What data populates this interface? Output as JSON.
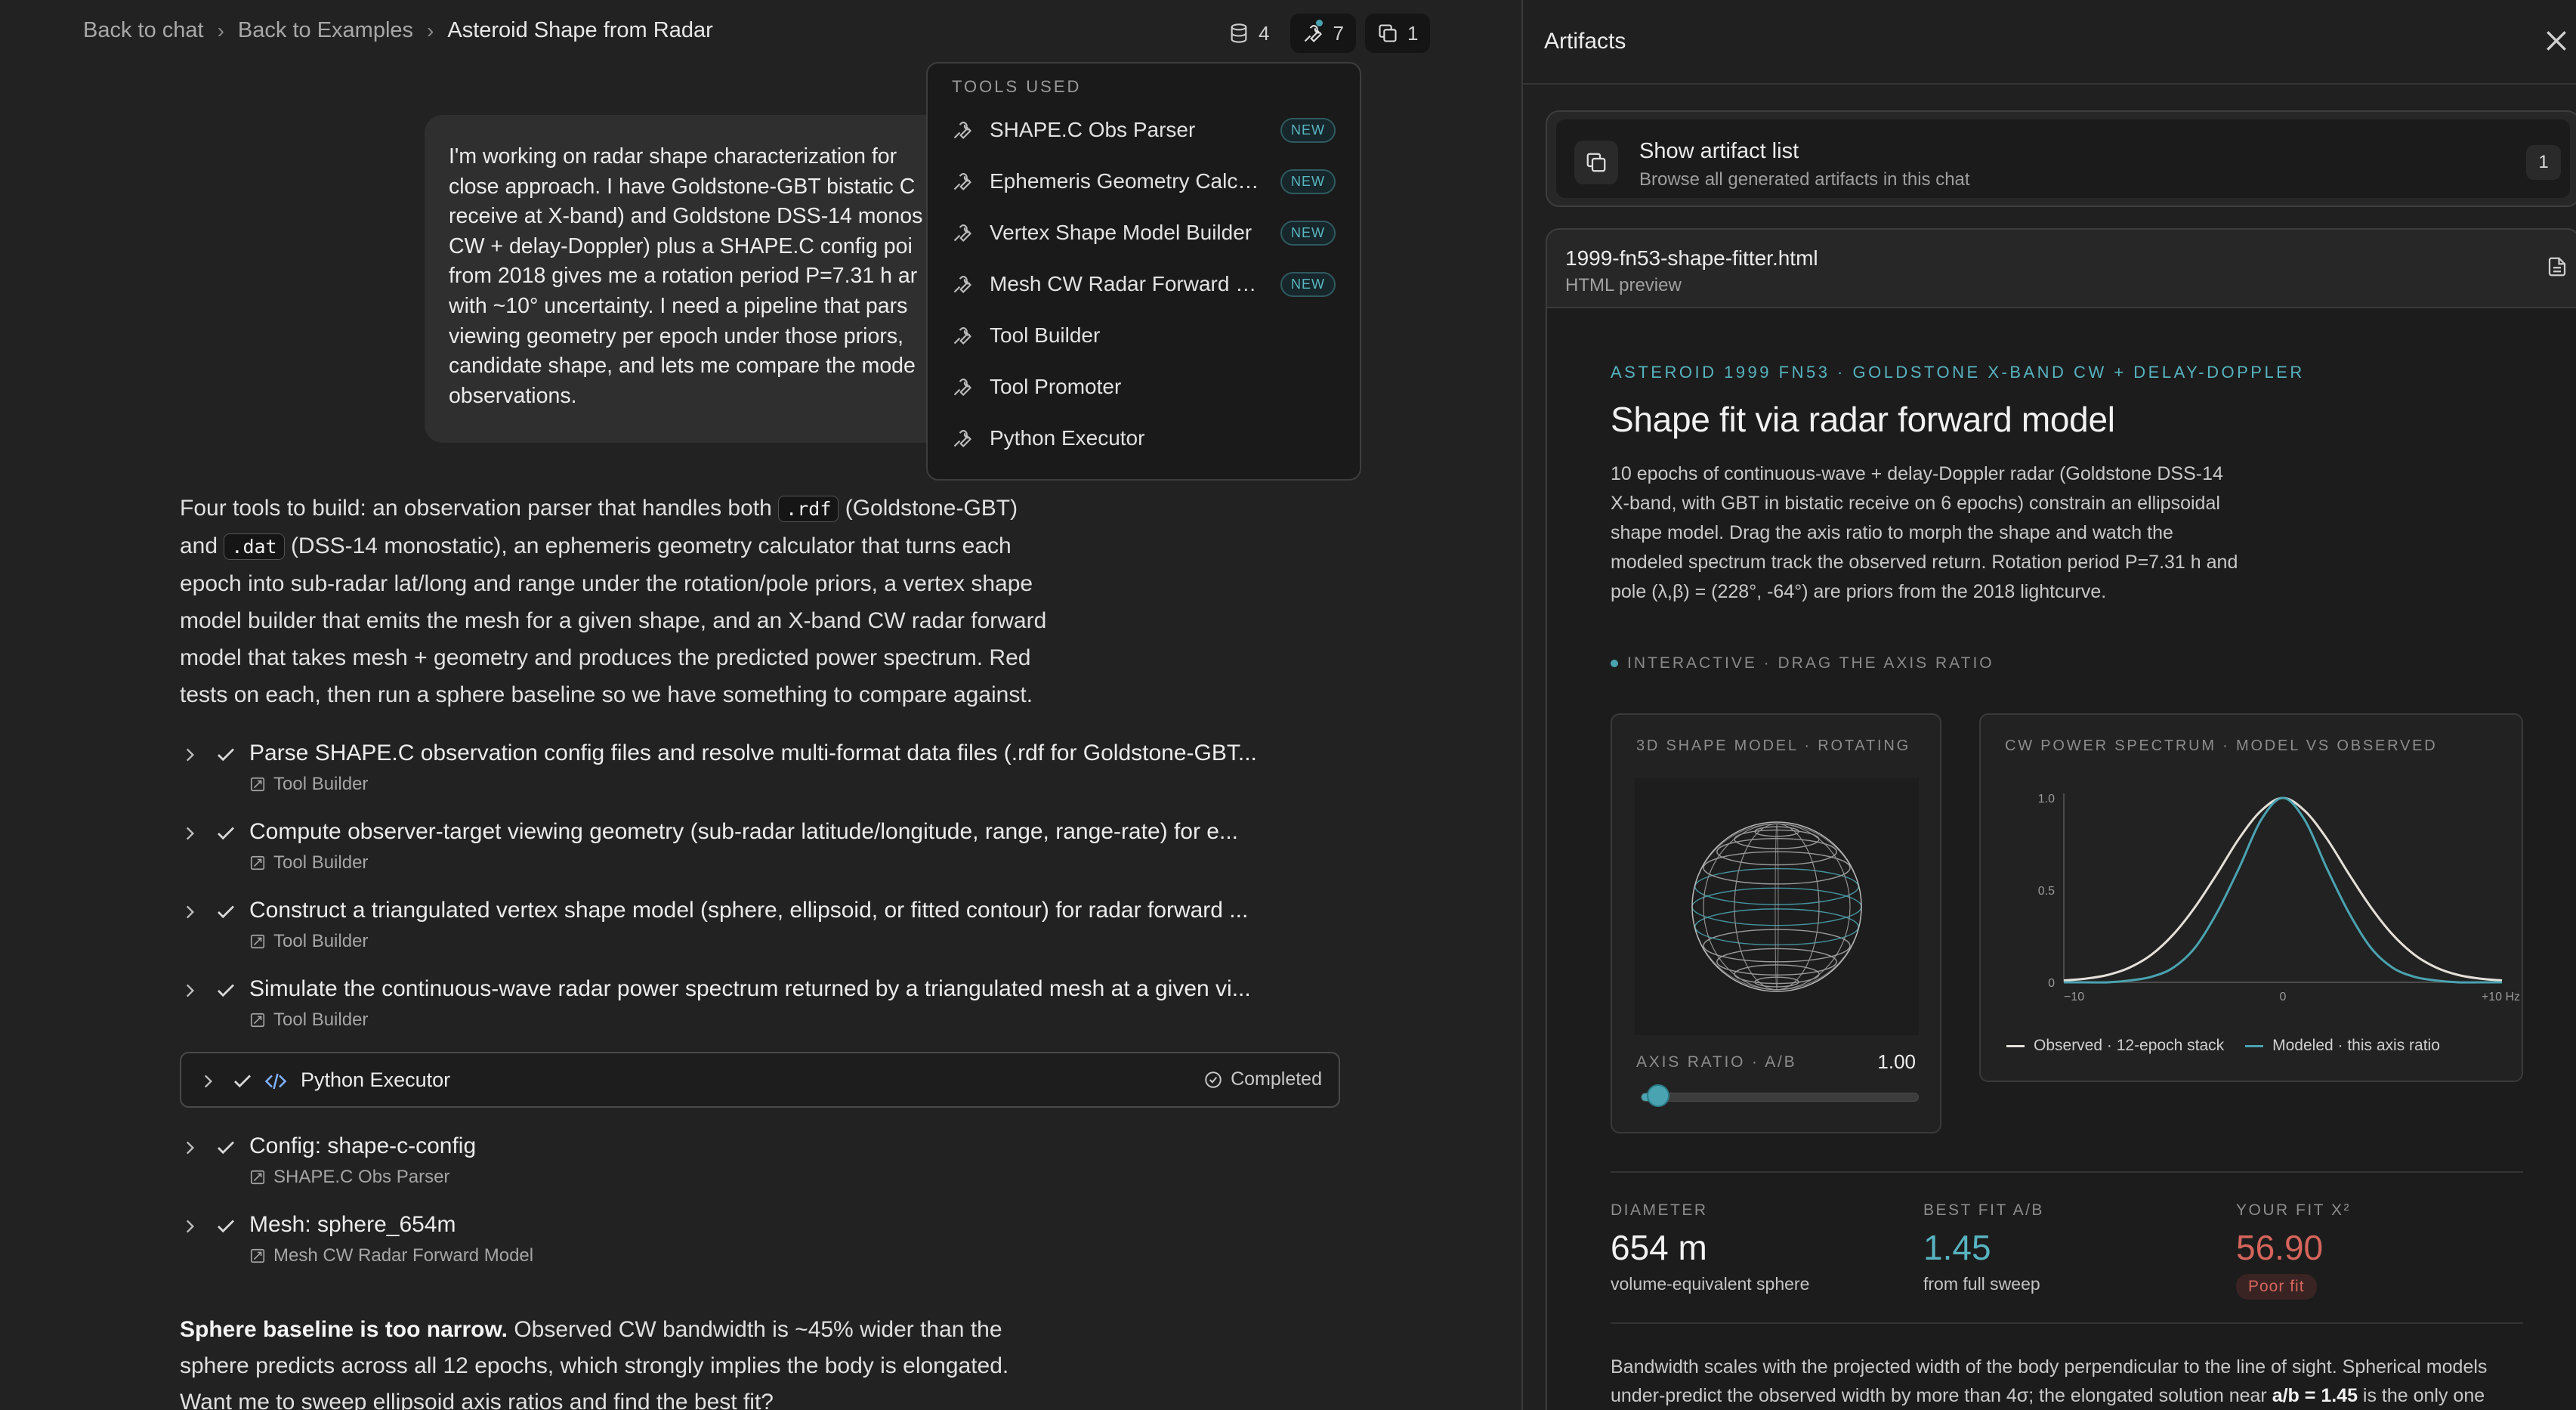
{
  "breadcrumb": {
    "back_to_chat": "Back to chat",
    "back_to_examples": "Back to Examples",
    "current": "Asteroid Shape from Radar"
  },
  "toolbar": {
    "database_count": "4",
    "tools_count": "7",
    "artifacts_count": "1"
  },
  "user_message": {
    "lines": [
      "I'm working on radar shape characterization for",
      "close approach. I have Goldstone-GBT bistatic C",
      "receive at X-band) and Goldstone DSS-14 monos",
      "CW + delay-Doppler) plus a SHAPE.C config poi",
      "from 2018 gives me a rotation period P=7.31 h ar",
      "with ~10° uncertainty. I need a pipeline that pars",
      "viewing geometry per epoch under those priors,",
      "candidate shape, and lets me compare the mode",
      "observations."
    ]
  },
  "tools_dropdown": {
    "header": "TOOLS USED",
    "items": [
      {
        "name": "SHAPE.C Obs Parser",
        "badge": "NEW"
      },
      {
        "name": "Ephemeris Geometry Calcu...",
        "badge": "NEW"
      },
      {
        "name": "Vertex Shape Model Builder",
        "badge": "NEW"
      },
      {
        "name": "Mesh CW Radar Forward M...",
        "badge": "NEW"
      },
      {
        "name": "Tool Builder",
        "badge": ""
      },
      {
        "name": "Tool Promoter",
        "badge": ""
      },
      {
        "name": "Python Executor",
        "badge": ""
      }
    ]
  },
  "assistant": {
    "p1_a": "Four tools to build: an observation parser that handles both ",
    "code_rdf": ".rdf",
    "p1_b": " (Goldstone-GBT)",
    "p1_c": "and ",
    "code_dat": ".dat",
    "p1_d": " (DSS-14 monostatic), an ephemeris geometry calculator that turns each",
    "p1_e": "epoch into sub-radar lat/long and range under the rotation/pole priors, a vertex shape",
    "p1_f": "model builder that emits the mesh for a given shape, and an X-band CW radar forward",
    "p1_g": "model that takes mesh + geometry and produces the predicted power spectrum. Red",
    "p1_h": "tests on each, then run a sphere baseline so we have something to compare against."
  },
  "steps": [
    {
      "title": "Parse SHAPE.C observation config files and resolve multi-format data files (.rdf for Goldstone-GBT...",
      "sub": "Tool Builder"
    },
    {
      "title": "Compute observer-target viewing geometry (sub-radar latitude/longitude, range, range-rate) for e...",
      "sub": "Tool Builder"
    },
    {
      "title": "Construct a triangulated vertex shape model (sphere, ellipsoid, or fitted contour) for radar forward ...",
      "sub": "Tool Builder"
    },
    {
      "title": "Simulate the continuous-wave radar power spectrum returned by a triangulated mesh at a given vi...",
      "sub": "Tool Builder"
    }
  ],
  "executor": {
    "title": "Python Executor",
    "status": "Completed"
  },
  "steps2": [
    {
      "title": "Config: shape-c-config",
      "sub": "SHAPE.C Obs Parser"
    },
    {
      "title": "Mesh: sphere_654m",
      "sub": "Mesh CW Radar Forward Model"
    }
  ],
  "summary": {
    "bold": "Sphere baseline is too narrow.",
    "rest1": " Observed CW bandwidth is ~45% wider than the",
    "rest2": "sphere predicts across all 12 epochs, which strongly implies the body is elongated.",
    "rest3": "Want me to sweep ellipsoid axis ratios and find the best fit?"
  },
  "artifacts_panel": {
    "title": "Artifacts",
    "list_title": "Show artifact list",
    "list_sub": "Browse all generated artifacts in this chat",
    "list_count": "1",
    "file_name": "1999-fn53-shape-fitter.html",
    "file_type": "HTML preview"
  },
  "viz": {
    "kicker": "ASTEROID 1999 FN53 · GOLDSTONE X-BAND CW + DELAY-DOPPLER",
    "title": "Shape fit via radar forward model",
    "desc_lines": [
      "10 epochs of continuous-wave + delay-Doppler radar (Goldstone DSS-14",
      "X-band, with GBT in bistatic receive on 6 epochs) constrain an ellipsoidal",
      "shape model. Drag the axis ratio to morph the shape and watch the",
      "modeled spectrum track the observed return. Rotation period P=7.31 h and",
      "pole (λ,β) = (228°, -64°) are priors from the 2018 lightcurve."
    ],
    "interactive": "INTERACTIVE · DRAG THE AXIS RATIO",
    "shape_label": "3D SHAPE MODEL · ROTATING",
    "axis_label": "AXIS RATIO · A/B",
    "axis_value": "1.00",
    "axis_min": 1.0,
    "axis_max": 2.0,
    "axis_current": 1.0,
    "spectrum_label": "CW POWER SPECTRUM · MODEL VS OBSERVED",
    "legend_observed": "Observed · 12-epoch stack",
    "legend_modeled": "Modeled · this axis ratio",
    "stats": {
      "diameter_label": "DIAMETER",
      "diameter_value": "654 m",
      "diameter_sub": "volume-equivalent sphere",
      "bestfit_label": "BEST FIT A/B",
      "bestfit_value": "1.45",
      "bestfit_sub": "from full sweep",
      "yourfit_label": "YOUR FIT X²",
      "yourfit_value": "56.90",
      "yourfit_badge": "Poor fit"
    },
    "bottom_a": "Bandwidth scales with the projected width of the body perpendicular to the line of sight. Spherical models",
    "bottom_b": "under-predict the observed width by more than 4σ; the elongated solution near ",
    "bottom_bold": "a/b = 1.45",
    "bottom_c": " is the only one"
  },
  "chart_data": {
    "type": "line",
    "title": "CW POWER SPECTRUM · MODEL VS OBSERVED",
    "x_ticks": [
      "−10",
      "0",
      "+10 Hz"
    ],
    "y_ticks": [
      "0",
      "0.5",
      "1.0"
    ],
    "xlim": [
      -10,
      10
    ],
    "ylim": [
      0,
      1.0
    ],
    "series": [
      {
        "name": "Observed · 12-epoch stack",
        "color": "#e4e0d8",
        "x": [
          -10,
          -9,
          -8,
          -7,
          -6,
          -5,
          -4,
          -3,
          -2,
          -1,
          0,
          1,
          2,
          3,
          4,
          5,
          6,
          7,
          8,
          9,
          10
        ],
        "y": [
          0.01,
          0.02,
          0.04,
          0.08,
          0.15,
          0.26,
          0.41,
          0.59,
          0.78,
          0.93,
          1.0,
          0.93,
          0.78,
          0.59,
          0.41,
          0.26,
          0.15,
          0.08,
          0.04,
          0.02,
          0.01
        ]
      },
      {
        "name": "Modeled · this axis ratio",
        "color": "#4aa3b0",
        "x": [
          -10,
          -9,
          -8,
          -7,
          -6,
          -5,
          -4,
          -3,
          -2,
          -1,
          0,
          1,
          2,
          3,
          4,
          5,
          6,
          7,
          8,
          9,
          10
        ],
        "y": [
          0.0,
          0.0,
          0.0,
          0.01,
          0.03,
          0.08,
          0.19,
          0.38,
          0.62,
          0.88,
          1.0,
          0.88,
          0.62,
          0.38,
          0.19,
          0.08,
          0.03,
          0.01,
          0.0,
          0.0,
          0.0
        ]
      }
    ],
    "grid": false,
    "legend": "bottom"
  },
  "colors": {
    "accent": "#4aa3b0",
    "bad": "#d5655c"
  }
}
